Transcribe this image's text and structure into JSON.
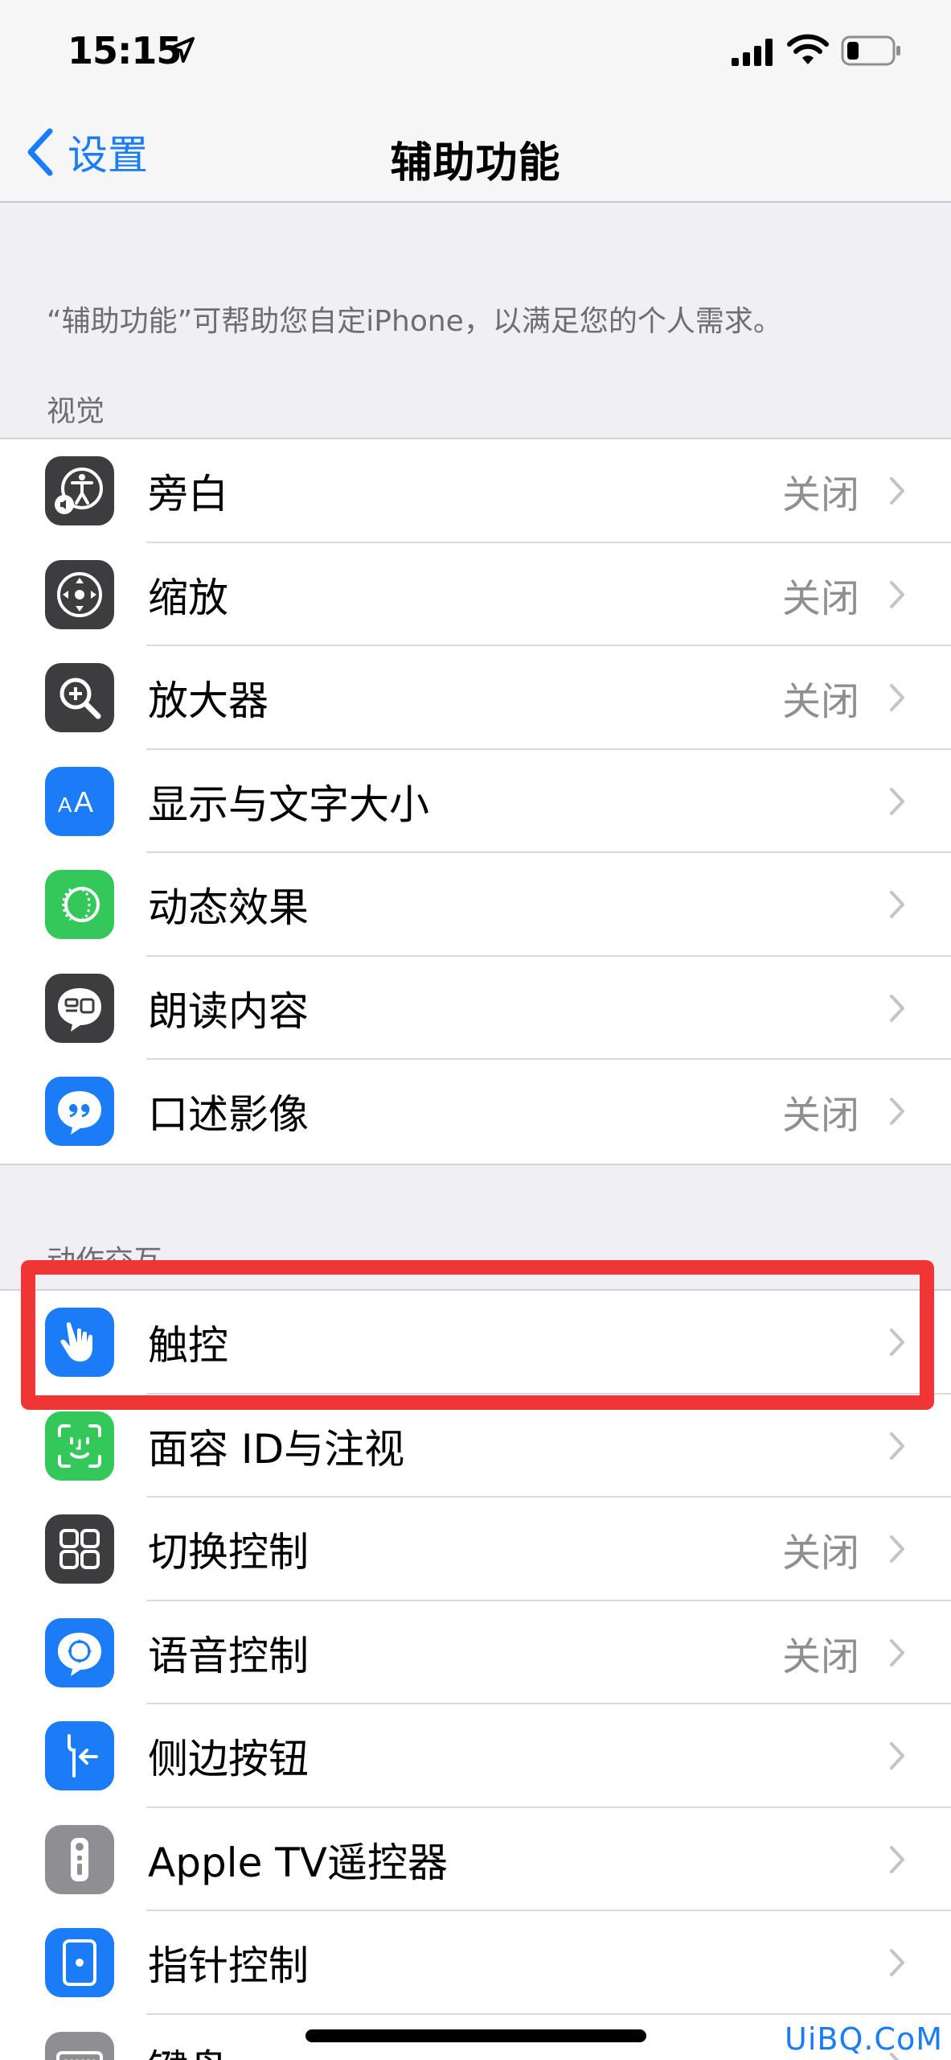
{
  "status_bar": {
    "time": "15:15"
  },
  "nav": {
    "back_label": "设置",
    "title": "辅助功能"
  },
  "intro": "“辅助功能”可帮助您自定iPhone，以满足您的个人需求。",
  "sections": {
    "visual": {
      "header": "视觉",
      "items": [
        {
          "label": "旁白",
          "value": "关闭",
          "icon": "voiceover-icon",
          "color": "#3d3d3f"
        },
        {
          "label": "缩放",
          "value": "关闭",
          "icon": "zoom-icon",
          "color": "#3d3d3f"
        },
        {
          "label": "放大器",
          "value": "关闭",
          "icon": "magnifier-icon",
          "color": "#3d3d3f"
        },
        {
          "label": "显示与文字大小",
          "value": "",
          "icon": "display-text-size-icon",
          "color": "#1a7cf6"
        },
        {
          "label": "动态效果",
          "value": "",
          "icon": "motion-icon",
          "color": "#34c759"
        },
        {
          "label": "朗读内容",
          "value": "",
          "icon": "spoken-content-icon",
          "color": "#3d3d3f"
        },
        {
          "label": "口述影像",
          "value": "关闭",
          "icon": "audio-description-icon",
          "color": "#1a7cf6"
        }
      ]
    },
    "motion": {
      "header": "动作交互",
      "items": [
        {
          "label": "触控",
          "value": "",
          "icon": "touch-icon",
          "color": "#1a7cf6"
        },
        {
          "label": "面容 ID与注视",
          "value": "",
          "icon": "face-id-icon",
          "color": "#34c759"
        },
        {
          "label": "切换控制",
          "value": "关闭",
          "icon": "switch-control-icon",
          "color": "#3d3d3f"
        },
        {
          "label": "语音控制",
          "value": "关闭",
          "icon": "voice-control-icon",
          "color": "#1a7cf6"
        },
        {
          "label": "侧边按钮",
          "value": "",
          "icon": "side-button-icon",
          "color": "#1a7cf6"
        },
        {
          "label": "Apple TV遥控器",
          "value": "",
          "icon": "apple-tv-remote-icon",
          "color": "#8e8e93"
        },
        {
          "label": "指针控制",
          "value": "",
          "icon": "pointer-control-icon",
          "color": "#1a7cf6"
        },
        {
          "label": "键盘",
          "value": "",
          "icon": "keyboard-icon",
          "color": "#8e8e93"
        }
      ]
    }
  },
  "watermark": "UiBQ.CoM",
  "colors": {
    "accent": "#1a7cf6",
    "highlight": "#ef3535"
  }
}
